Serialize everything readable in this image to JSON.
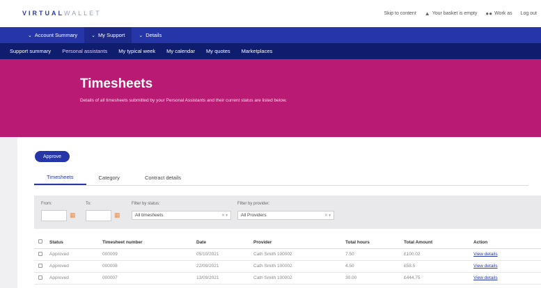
{
  "brand": {
    "part1": "VIRTUAL",
    "part2": "WALLET"
  },
  "toplinks": {
    "skip": "Skip to content",
    "basket": "Your basket is empty",
    "workas": "Work as",
    "logout": "Log out"
  },
  "nav1": [
    "Account Summary",
    "My Support",
    "Details"
  ],
  "nav2": [
    "Support summary",
    "Personal assistants",
    "My typical week",
    "My calendar",
    "My quotes",
    "Marketplaces"
  ],
  "hero": {
    "title": "Timesheets",
    "desc": "Details of all timesheets submitted by your Personal Assistants and their current status are listed below."
  },
  "approve_label": "Approve",
  "tabs": [
    "Timesheets",
    "Category",
    "Contract details"
  ],
  "filters": {
    "from_label": "From:",
    "to_label": "To:",
    "status_label": "Filter by status:",
    "status_value": "All timesheets",
    "provider_label": "Filter by provider:",
    "provider_value": "All Providers"
  },
  "table": {
    "headers": [
      "Status",
      "Timesheet number",
      "Date",
      "Provider",
      "Total hours",
      "Total Amount",
      "Action"
    ],
    "rows": [
      [
        "Approved",
        "000009",
        "05/10/2021",
        "Cath Smith 100002",
        "7.50",
        "£100.02",
        "View details"
      ],
      [
        "Approved",
        "000008",
        "22/09/2021",
        "Cath Smith 100002",
        "4.50",
        "£58.5",
        "View details"
      ],
      [
        "Approved",
        "000007",
        "13/09/2021",
        "Cath Smith 100002",
        "30.00",
        "£444.75",
        "View details"
      ]
    ]
  },
  "colors": {
    "primary": "#2636a8",
    "navdark": "#0f1d6e",
    "hero": "#b81a74",
    "accent": "#e8904a"
  }
}
